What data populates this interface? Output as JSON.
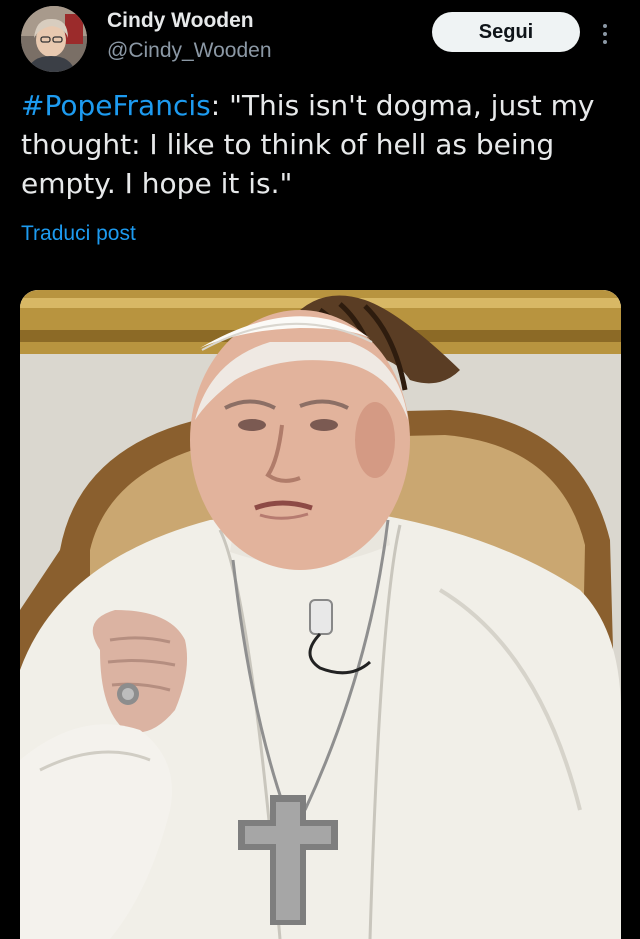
{
  "author": {
    "display_name": "Cindy Wooden",
    "handle": "@Cindy_Wooden"
  },
  "actions": {
    "follow_label": "Segui",
    "more_icon": "more-vertical-icon"
  },
  "post": {
    "hashtag": "#PopeFrancis",
    "text": ": \"This isn't dogma, just my thought: I like to think of hell as being empty. I hope it is.\"",
    "translate_label": "Traduci post"
  },
  "colors": {
    "background": "#000000",
    "text": "#e7e9ea",
    "secondary": "#8b98a5",
    "accent": "#1d9bf0",
    "button_bg": "#eff3f4"
  }
}
